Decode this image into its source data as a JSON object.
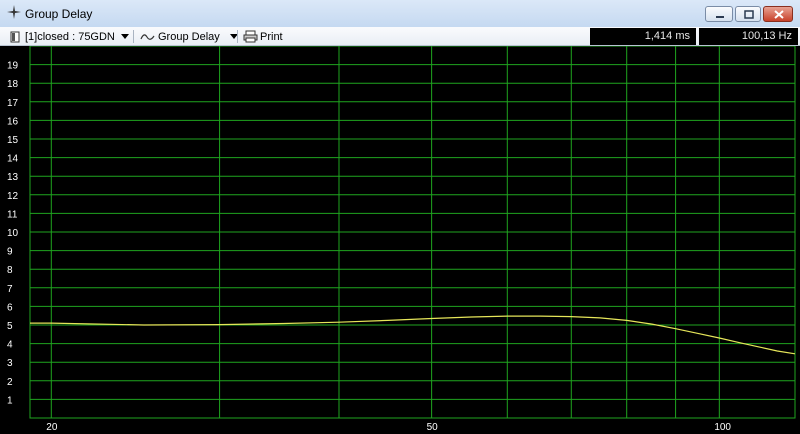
{
  "window": {
    "title": "Group Delay",
    "title_icon": "crosshair-icon",
    "buttons": [
      "minimize-icon",
      "maximize-icon",
      "close-icon"
    ]
  },
  "toolbar": {
    "measurement_label": "[1]closed : 75GDN",
    "measurement_icon": "document-icon",
    "mode_label": "Group Delay",
    "mode_icon": "waveform-icon",
    "print_label": "Print",
    "print_icon": "printer-icon",
    "readout_time": "1,414 ms",
    "readout_freq": "100,13 Hz"
  },
  "colors": {
    "background": "#000000",
    "grid": "#1fa51f",
    "trace": "#e6e65a",
    "axis_text": "#ffffff"
  },
  "chart_data": {
    "type": "line",
    "xscale": "log",
    "xlim": [
      19,
      120
    ],
    "ylim": [
      0,
      20
    ],
    "grid": true,
    "y_ticks": [
      "1",
      "2",
      "3",
      "4",
      "5",
      "6",
      "7",
      "8",
      "9",
      "10",
      "11",
      "12",
      "13",
      "14",
      "15",
      "16",
      "17",
      "18",
      "19"
    ],
    "x_tick_labels": [
      {
        "value": 20,
        "label": "20"
      },
      {
        "value": 50,
        "label": "50"
      },
      {
        "value": 100,
        "label": "100"
      }
    ],
    "x_gridlines": [
      20,
      30,
      40,
      50,
      60,
      70,
      80,
      90,
      100
    ],
    "series": [
      {
        "x": [
          19,
          20,
          25,
          30,
          35,
          40,
          45,
          50,
          55,
          60,
          65,
          70,
          75,
          80,
          85,
          90,
          95,
          100,
          105,
          110,
          115,
          120
        ],
        "y": [
          5.1,
          5.1,
          5.0,
          5.02,
          5.08,
          5.15,
          5.25,
          5.35,
          5.43,
          5.48,
          5.48,
          5.45,
          5.38,
          5.25,
          5.05,
          4.8,
          4.55,
          4.3,
          4.05,
          3.82,
          3.6,
          3.45
        ]
      }
    ]
  }
}
